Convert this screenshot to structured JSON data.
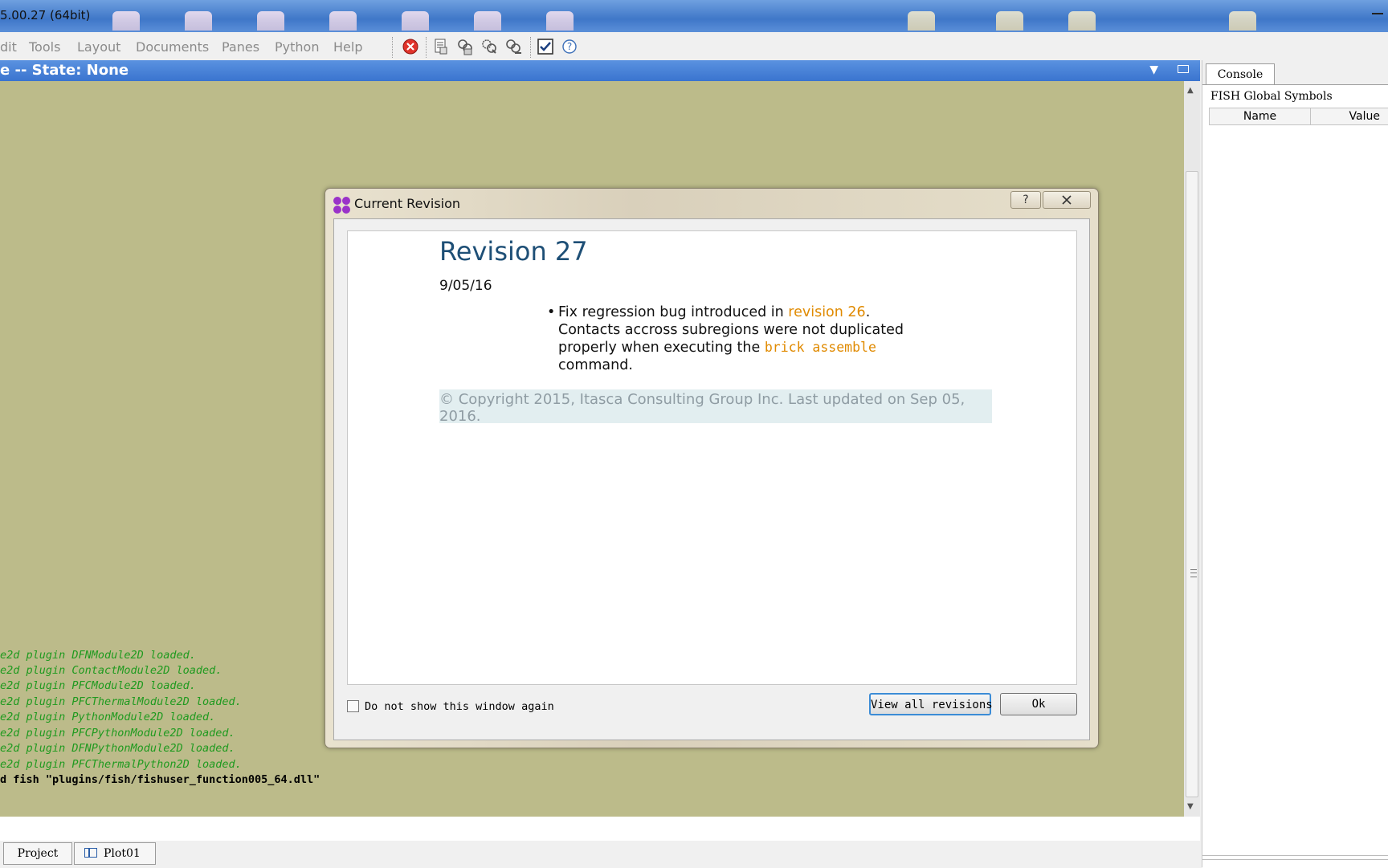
{
  "window": {
    "title": "5.00.27 (64bit)"
  },
  "menu": {
    "items": [
      "dit",
      "Tools",
      "Layout",
      "Documents",
      "Panes",
      "Python",
      "Help"
    ]
  },
  "pane": {
    "title": "e -- State: None"
  },
  "log": {
    "lines": [
      "e2d plugin DFNModule2D loaded.",
      "e2d plugin ContactModule2D loaded.",
      "e2d plugin PFCModule2D loaded.",
      "e2d plugin PFCThermalModule2D loaded.",
      "e2d plugin PythonModule2D loaded.",
      "e2d plugin PFCPythonModule2D loaded.",
      "e2d plugin DFNPythonModule2D loaded.",
      "e2d plugin PFCThermalPython2D loaded."
    ],
    "command": "d fish \"plugins/fish/fishuser_function005_64.dll\""
  },
  "bottom_tabs": {
    "project": "Project",
    "plot": "Plot01"
  },
  "right_panel": {
    "tab": "Console",
    "label": "FISH Global Symbols",
    "col_name": "Name",
    "col_value": "Value"
  },
  "dialog": {
    "title": "Current Revision",
    "help_btn": "?",
    "revision_title": "Revision 27",
    "date": "9/05/16",
    "bullet": {
      "part1": "Fix regression bug introduced in ",
      "link": "revision 26",
      "part2": ". Contacts accross subregions were not duplicated properly when executing the ",
      "code": "brick assemble",
      "part3": " command."
    },
    "copyright": "© Copyright 2015, Itasca Consulting Group Inc. Last updated on Sep 05, 2016.",
    "checkbox_label": "Do not show this window again",
    "view_all_label": "View all revisions",
    "ok_label": "Ok"
  },
  "icons": {
    "stop": "stop-icon",
    "help": "help-icon"
  },
  "colors": {
    "canvas": "#bcbb8a",
    "log_green": "#1f9a1f",
    "accent": "#3a74cf",
    "link_orange": "#e08a00"
  }
}
